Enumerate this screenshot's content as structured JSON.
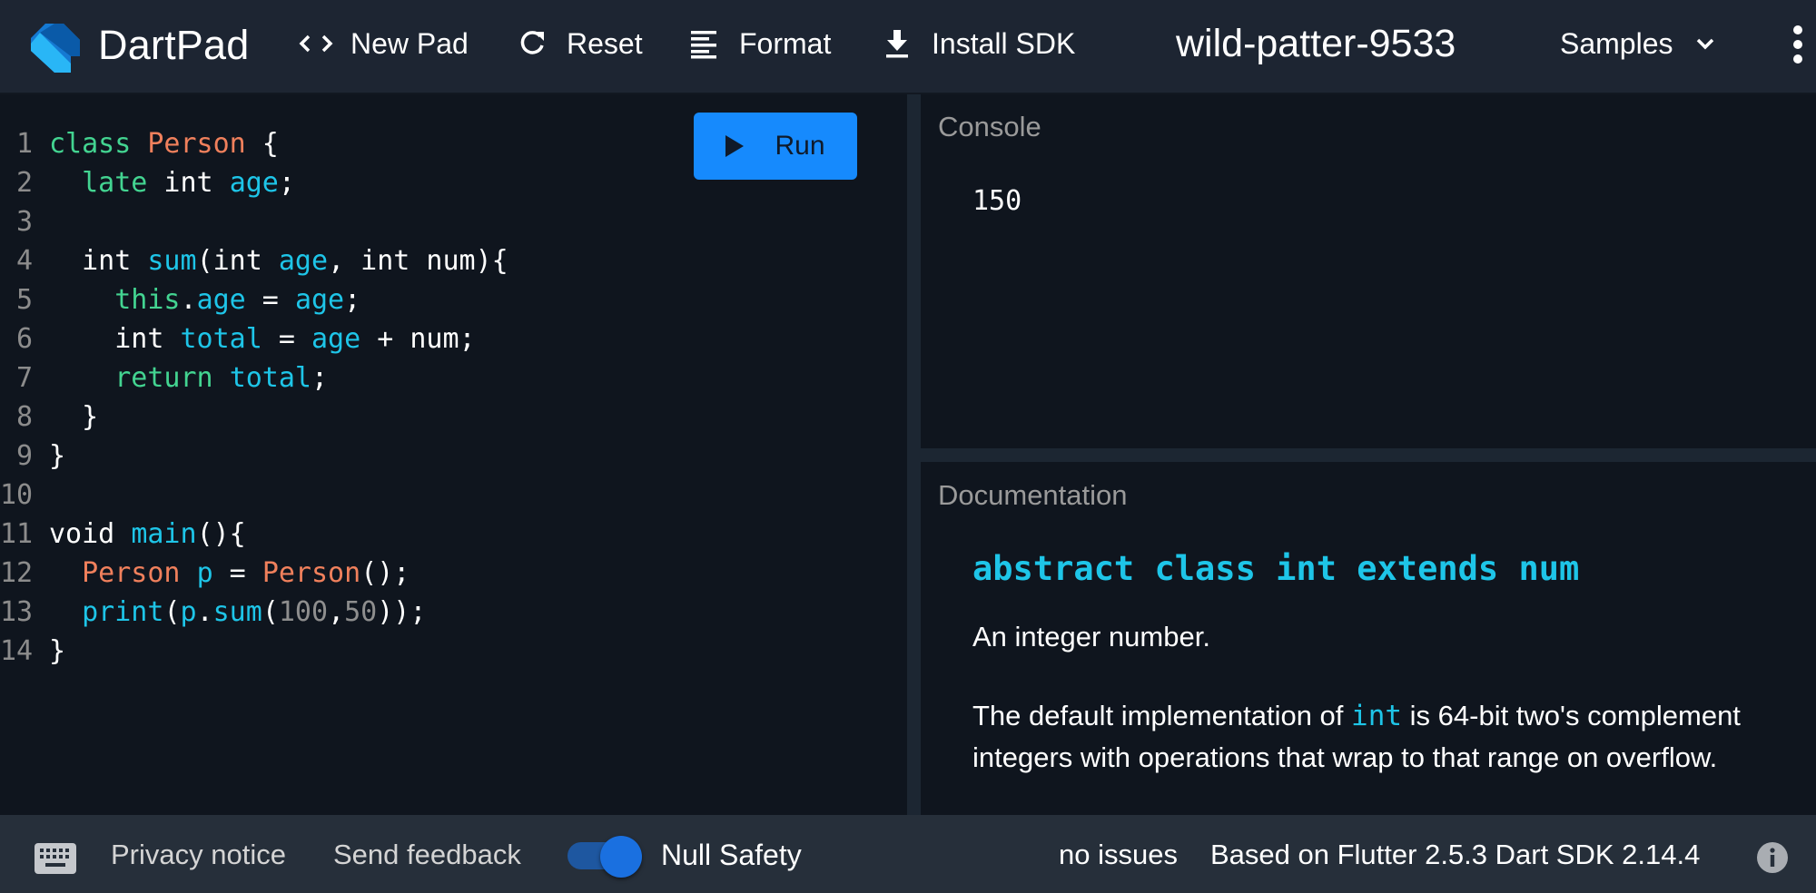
{
  "header": {
    "brand": "DartPad",
    "buttons": {
      "new_pad": "New Pad",
      "reset": "Reset",
      "format": "Format",
      "install_sdk": "Install SDK"
    },
    "pad_title": "wild-patter-9533",
    "samples_label": "Samples"
  },
  "editor": {
    "run_label": "Run",
    "lines": [
      {
        "n": "1",
        "tokens": [
          [
            "kw",
            "class"
          ],
          [
            "plain",
            " "
          ],
          [
            "type",
            "Person"
          ],
          [
            "plain",
            " {"
          ]
        ]
      },
      {
        "n": "2",
        "tokens": [
          [
            "plain",
            "  "
          ],
          [
            "kw",
            "late"
          ],
          [
            "plain",
            " int "
          ],
          [
            "id",
            "age"
          ],
          [
            "plain",
            ";"
          ]
        ]
      },
      {
        "n": "3",
        "tokens": []
      },
      {
        "n": "4",
        "tokens": [
          [
            "plain",
            "  int "
          ],
          [
            "id",
            "sum"
          ],
          [
            "plain",
            "(int "
          ],
          [
            "id",
            "age"
          ],
          [
            "plain",
            ", int num){"
          ]
        ]
      },
      {
        "n": "5",
        "tokens": [
          [
            "plain",
            "    "
          ],
          [
            "kw",
            "this"
          ],
          [
            "plain",
            "."
          ],
          [
            "id",
            "age"
          ],
          [
            "plain",
            " = "
          ],
          [
            "id",
            "age"
          ],
          [
            "plain",
            ";"
          ]
        ]
      },
      {
        "n": "6",
        "tokens": [
          [
            "plain",
            "    int "
          ],
          [
            "id",
            "total"
          ],
          [
            "plain",
            " = "
          ],
          [
            "id",
            "age"
          ],
          [
            "plain",
            " + num;"
          ]
        ]
      },
      {
        "n": "7",
        "tokens": [
          [
            "plain",
            "    "
          ],
          [
            "kw",
            "return"
          ],
          [
            "plain",
            " "
          ],
          [
            "id",
            "total"
          ],
          [
            "plain",
            ";"
          ]
        ]
      },
      {
        "n": "8",
        "tokens": [
          [
            "plain",
            "  }"
          ]
        ]
      },
      {
        "n": "9",
        "tokens": [
          [
            "plain",
            "}"
          ]
        ]
      },
      {
        "n": "10",
        "tokens": []
      },
      {
        "n": "11",
        "tokens": [
          [
            "plain",
            "void "
          ],
          [
            "id",
            "main"
          ],
          [
            "plain",
            "(){"
          ]
        ]
      },
      {
        "n": "12",
        "tokens": [
          [
            "plain",
            "  "
          ],
          [
            "type",
            "Person"
          ],
          [
            "plain",
            " "
          ],
          [
            "id",
            "p"
          ],
          [
            "plain",
            " = "
          ],
          [
            "type",
            "Person"
          ],
          [
            "plain",
            "();"
          ]
        ]
      },
      {
        "n": "13",
        "tokens": [
          [
            "plain",
            "  "
          ],
          [
            "id",
            "print"
          ],
          [
            "plain",
            "("
          ],
          [
            "id",
            "p"
          ],
          [
            "plain",
            "."
          ],
          [
            "id",
            "sum"
          ],
          [
            "plain",
            "("
          ],
          [
            "num",
            "100"
          ],
          [
            "plain",
            ","
          ],
          [
            "num",
            "50"
          ],
          [
            "plain",
            "));"
          ]
        ]
      },
      {
        "n": "14",
        "tokens": [
          [
            "plain",
            "}"
          ]
        ]
      }
    ]
  },
  "console": {
    "label": "Console",
    "output": "150"
  },
  "documentation": {
    "label": "Documentation",
    "signature": "abstract class int extends num",
    "summary": "An integer number.",
    "detail_before": "The default implementation of ",
    "detail_code": "int",
    "detail_after": " is 64-bit two's complement integers with operations that wrap to that range on overflow."
  },
  "footer": {
    "privacy": "Privacy notice",
    "feedback": "Send feedback",
    "null_safety_label": "Null Safety",
    "null_safety_enabled": true,
    "issues": "no issues",
    "version": "Based on Flutter 2.5.3 Dart SDK 2.14.4"
  },
  "colors": {
    "header_bg": "#1d2532",
    "editor_bg": "#0f151e",
    "footer_bg": "#262f3a",
    "run_button": "#168afd",
    "keyword": "#43d491",
    "type": "#f0805c",
    "identifier": "#1ec5e8",
    "number": "#8e8e8e"
  }
}
